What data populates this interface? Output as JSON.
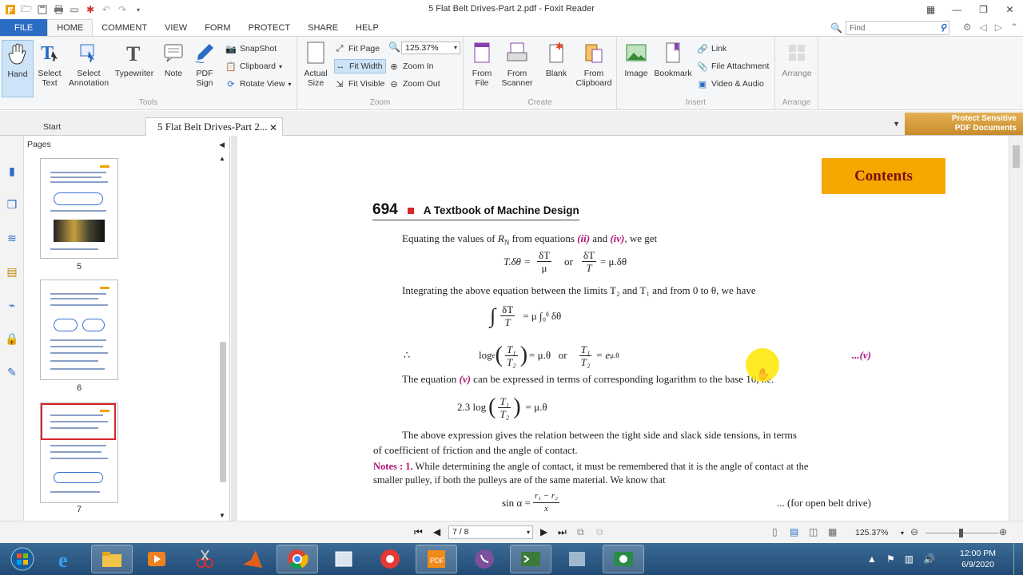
{
  "window": {
    "title": "5  Flat Belt Drives-Part 2.pdf - Foxit Reader"
  },
  "ribbon_tabs": [
    "FILE",
    "HOME",
    "COMMENT",
    "VIEW",
    "FORM",
    "PROTECT",
    "SHARE",
    "HELP"
  ],
  "find": {
    "placeholder": "Find"
  },
  "tools": {
    "group": "Tools",
    "hand": "Hand",
    "select_text": "Select\nText",
    "select_annotation": "Select\nAnnotation",
    "typewriter": "Typewriter",
    "note": "Note",
    "pdf_sign": "PDF\nSign",
    "snapshot": "SnapShot",
    "clipboard": "Clipboard",
    "rotate_view": "Rotate View"
  },
  "zoom": {
    "group": "Zoom",
    "actual_size": "Actual\nSize",
    "fit_page": "Fit Page",
    "fit_width": "Fit Width",
    "fit_visible": "Fit Visible",
    "value": "125.37%",
    "zoom_in": "Zoom In",
    "zoom_out": "Zoom Out"
  },
  "create": {
    "group": "Create",
    "from_file": "From\nFile",
    "from_scanner": "From\nScanner",
    "blank": "Blank",
    "from_clipboard": "From\nClipboard"
  },
  "insert": {
    "group": "Insert",
    "image": "Image",
    "bookmark": "Bookmark",
    "link": "Link",
    "file_attachment": "File Attachment",
    "video_audio": "Video & Audio"
  },
  "arrange": {
    "group": "Arrange",
    "label": "Arrange"
  },
  "doc_tabs": {
    "start": "Start",
    "doc": "5  Flat Belt Drives-Part 2..."
  },
  "protect_banner": [
    "Protect Sensitive",
    "PDF Documents"
  ],
  "pages_panel": {
    "title": "Pages",
    "thumbs": [
      {
        "num": "5",
        "selected": false
      },
      {
        "num": "6",
        "selected": false
      },
      {
        "num": "7",
        "selected": true
      }
    ]
  },
  "document": {
    "contents_button": "Contents",
    "page_number": "694",
    "book_title": "A Textbook of Machine Design",
    "p1a": "Equating the values of ",
    "p1_rn": "R",
    "p1_rn_sub": "N",
    "p1b": " from equations ",
    "p1_ii": "(ii)",
    "p1c": " and ",
    "p1_iv": "(iv)",
    "p1d": ", we get",
    "eq1_lhs": "T.δθ  =",
    "eq1_f1n": "δT",
    "eq1_f1d": "μ",
    "eq1_or": "or",
    "eq1_f2n": "δT",
    "eq1_f2d": "T",
    "eq1_rhs": "= μ.δθ",
    "p2": "Integrating the above equation between the limits T₂ and T₁ and from 0 to θ, we have",
    "eq2_lhs": "∫",
    "eq2_fn": "δT",
    "eq2_fd": "T",
    "eq2_rhs": "= μ ∫₀ᶿ δθ",
    "eq3_therefore": "∴",
    "eq3_log": "log",
    "eq3_sub": "e",
    "eq3_fn": "T₁",
    "eq3_fd": "T₂",
    "eq3_mid": "= μ.θ   or",
    "eq3_rhs": "= e",
    "eq3_exp": "μ.θ",
    "eq3_ref": "...(v)",
    "p3a": "The equation ",
    "p3_v": "(v)",
    "p3b": " can be expressed in terms of corresponding logarithm to the base 10, ",
    "p3_ie": "i.e.",
    "eq4_lhs": "2.3 log",
    "eq4_fn": "T₁",
    "eq4_fd": "T₂",
    "eq4_rhs": "= μ.θ",
    "p4a": "The above expression gives the relation between the tight side and slack side tensions, in terms",
    "p4b": "of coefficient of friction and the angle of contact.",
    "notes_label": "Notes : 1.",
    "notes_a": " While determining the angle of contact, it must be remembered that it is the angle of contact at the",
    "notes_b": "smaller pulley, if both the pulleys are of the same material. We know that",
    "eq5_lhs": "sin α =",
    "eq5_fn": "r₁ − r₂",
    "eq5_fd": "x",
    "eq5_ref": "... (for open belt drive)"
  },
  "statusbar": {
    "page": "7 / 8",
    "zoom": "125.37%"
  },
  "taskbar": {
    "time": "12:00 PM",
    "date": "6/9/2020"
  },
  "colors": {
    "file_tab": "#2b6cc4",
    "contents_bg": "#f6a800",
    "accent_magenta": "#b0137a",
    "selected_thumb": "#d9242c"
  }
}
